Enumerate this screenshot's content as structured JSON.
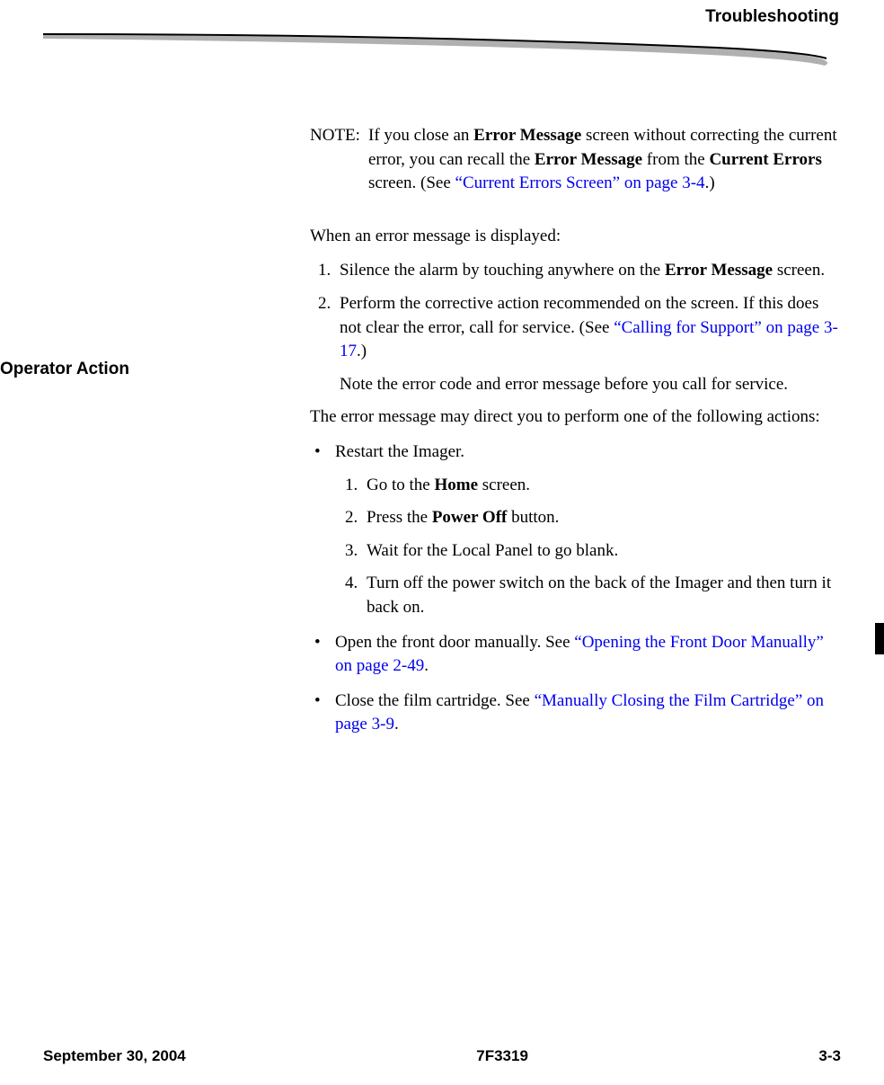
{
  "header": {
    "section_title": "Troubleshooting"
  },
  "note": {
    "label": "NOTE:",
    "text_parts": {
      "p1": "If you close an ",
      "b1": "Error Message",
      "p2": " screen without correcting the current error, you can recall the ",
      "b2": "Error Message",
      "p3": " from the ",
      "b3": "Current Errors",
      "p4": " screen. (See ",
      "link": "“Current Errors Screen” on page 3-4",
      "p5": ".)"
    }
  },
  "sidebar": {
    "heading": "Operator Action"
  },
  "body": {
    "intro": "When an error message is displayed:",
    "step1_parts": {
      "p1": "Silence the alarm by touching anywhere on the ",
      "b1": "Error Message",
      "p2": " screen."
    },
    "step2_parts": {
      "p1": "Perform the corrective action recommended on the screen. If this does not clear the error, call for service. (See ",
      "link": "“Calling for Support” on page 3-17",
      "p2": ".)",
      "sub": "Note the error code and error message before you call for service."
    },
    "mid": "The error message may direct you to perform one of the following actions:",
    "bullet1": {
      "text": "Restart the Imager.",
      "sub1": {
        "p1": "Go to the ",
        "b1": "Home",
        "p2": " screen."
      },
      "sub2": {
        "p1": "Press the ",
        "b1": "Power Off",
        "p2": " button."
      },
      "sub3": "Wait for the Local Panel to go blank.",
      "sub4": "Turn off the power switch on the back of the Imager and then turn it back on."
    },
    "bullet2": {
      "p1": "Open the front door manually. See ",
      "link": "“Opening the Front Door Manually” on page 2-49",
      "p2": "."
    },
    "bullet3": {
      "p1": "Close the film cartridge. See ",
      "link": "“Manually Closing the Film Cartridge” on page 3-9",
      "p2": "."
    }
  },
  "footer": {
    "date": "September 30, 2004",
    "doc_id": "7F3319",
    "page": "3-3"
  }
}
